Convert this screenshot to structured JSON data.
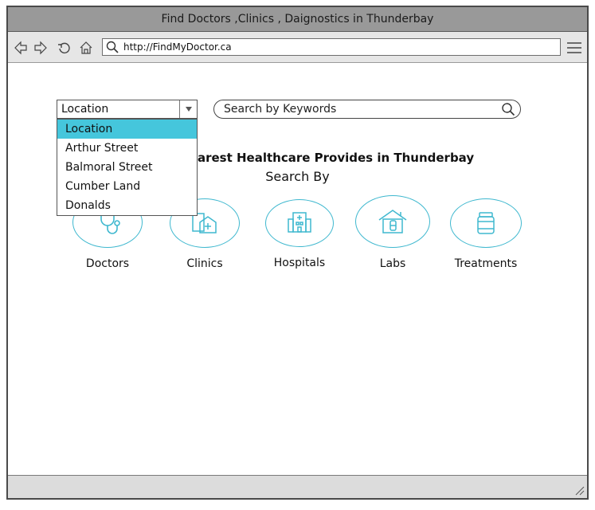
{
  "window": {
    "title": "Find Doctors ,Clinics , Daignostics in Thunderbay"
  },
  "browser": {
    "url": "http://FindMyDoctor.ca"
  },
  "location_select": {
    "selected": "Location",
    "options": [
      "Location",
      "Arthur Street",
      "Balmoral Street",
      "Cumber Land",
      "Donalds"
    ]
  },
  "search": {
    "placeholder": "Search by Keywords"
  },
  "headline": "Find the nearest Healthcare Provides in Thunderbay",
  "subhead": "Search By",
  "categories": [
    {
      "label": "Doctors",
      "icon": "stethoscope-icon"
    },
    {
      "label": "Clinics",
      "icon": "clinic-icon"
    },
    {
      "label": "Hospitals",
      "icon": "hospital-icon"
    },
    {
      "label": "Labs",
      "icon": "lab-icon"
    },
    {
      "label": "Treatments",
      "icon": "medicine-jar-icon"
    }
  ],
  "colors": {
    "accent": "#45c6dc",
    "titlebar": "#999999",
    "icon_stroke": "#3fb8cf"
  }
}
